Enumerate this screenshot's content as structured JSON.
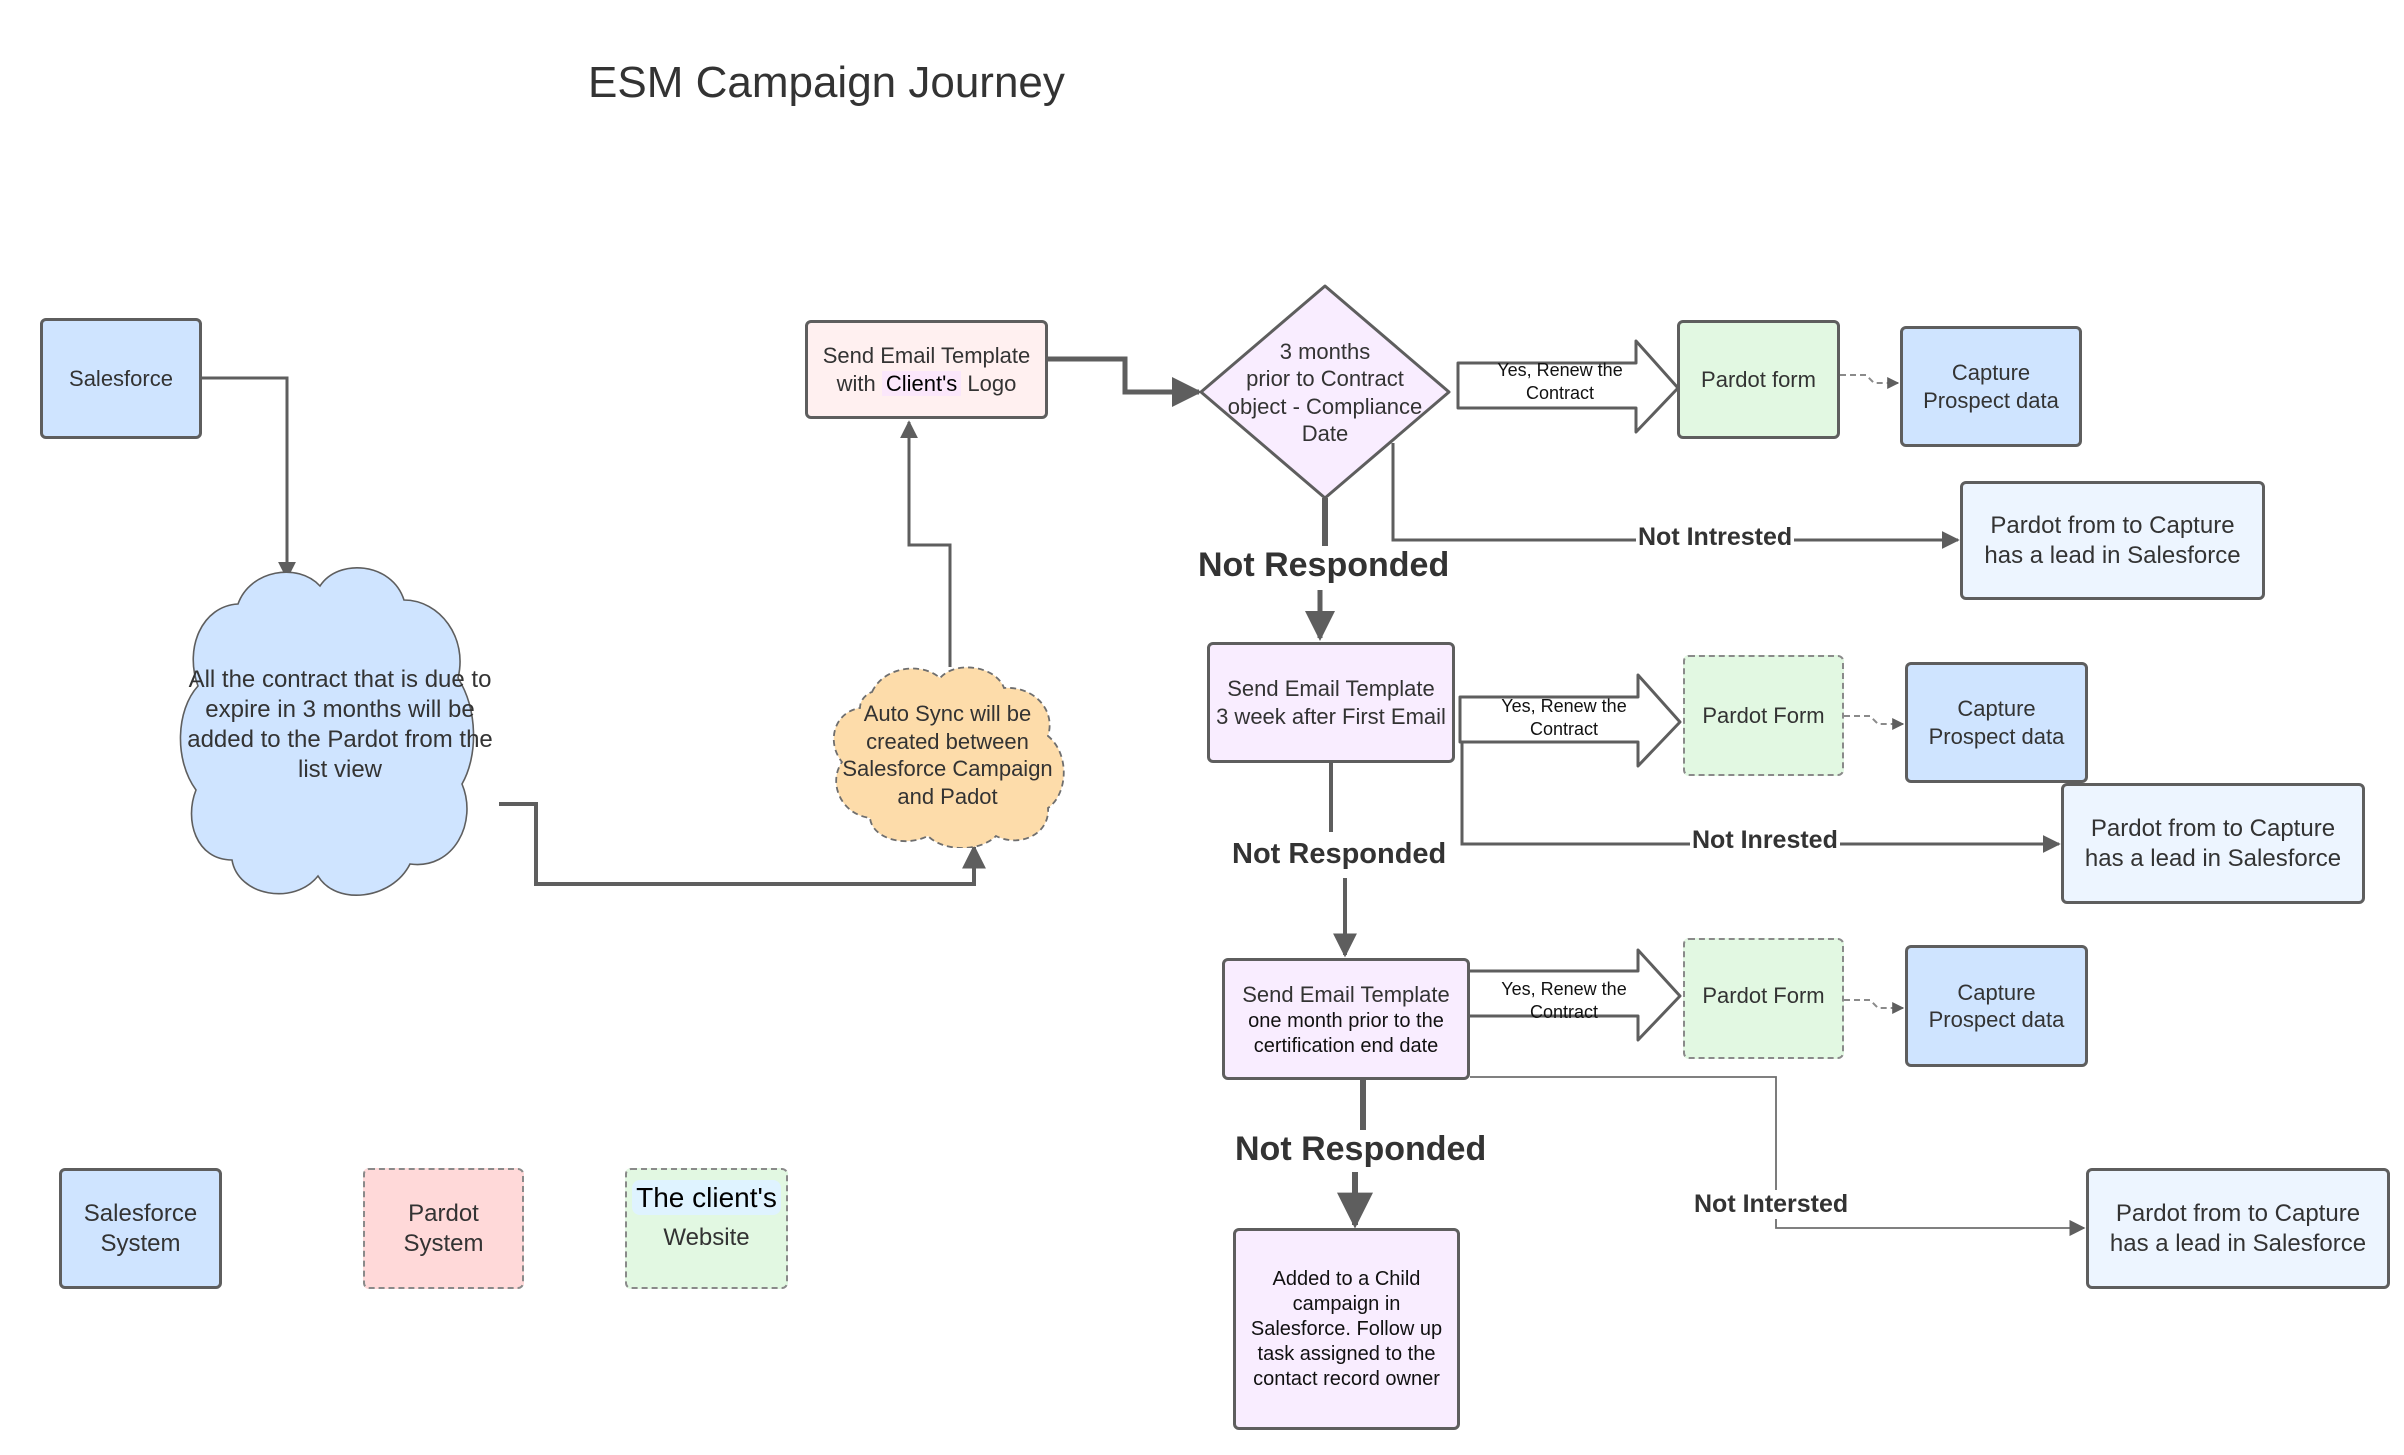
{
  "title": "ESM Campaign Journey",
  "colors": {
    "salesforce_fill": "#cfe4ff",
    "pardot_fill": "#ffd9d9",
    "website_fill": "#e2f8e2",
    "email_fill": "#f9edff",
    "email_first_fill": "#fff0f0",
    "auto_sync_fill": "#fddcaa",
    "lead_fill": "#edf5ff",
    "stroke": "#5e5e5e"
  },
  "nodes": {
    "salesforce": "Salesforce",
    "contracts_cloud": "All the contract that is due to expire in 3 months will be added to the Pardot from the list view",
    "auto_sync_cloud": "Auto Sync will be created between Salesforce Campaign and Padot",
    "email_1": {
      "line1": "Send Email Template",
      "line2_prefix": "with ",
      "highlight": "Client's",
      "line2_suffix": " Logo"
    },
    "decision": "3 months\nprior to Contract\nobject - Compliance\nDate",
    "email_2": "Send Email Template\n3 week after First Email",
    "email_3": {
      "line1": "Send Email Template",
      "line2": "one month prior to the\ncertification end date"
    },
    "child_campaign": "Added to a Child campaign in Salesforce. Follow up task assigned to the contact record owner",
    "pardot_form_1": "Pardot form",
    "pardot_form_2": "Pardot Form",
    "pardot_form_3": "Pardot Form",
    "capture_1": "Capture\nProspect data",
    "capture_2": "Capture\nProspect data",
    "capture_3": "Capture\nProspect data",
    "lead_1": "Pardot from to Capture\nhas a lead in Salesforce",
    "lead_2": "Pardot from to Capture\nhas a lead in Salesforce",
    "lead_3": "Pardot from to Capture\nhas a lead in Salesforce"
  },
  "edge_labels": {
    "yes_renew": "Yes, Renew the\nContract",
    "not_responded": "Not Responded",
    "not_interested_1": "Not Intrested",
    "not_interested_2": "Not Inrested",
    "not_interested_3": "Not Intersted"
  },
  "legend": {
    "salesforce": "Salesforce\nSystem",
    "pardot": "Pardot\nSystem",
    "website_highlight": "The client's",
    "website": "Website"
  }
}
